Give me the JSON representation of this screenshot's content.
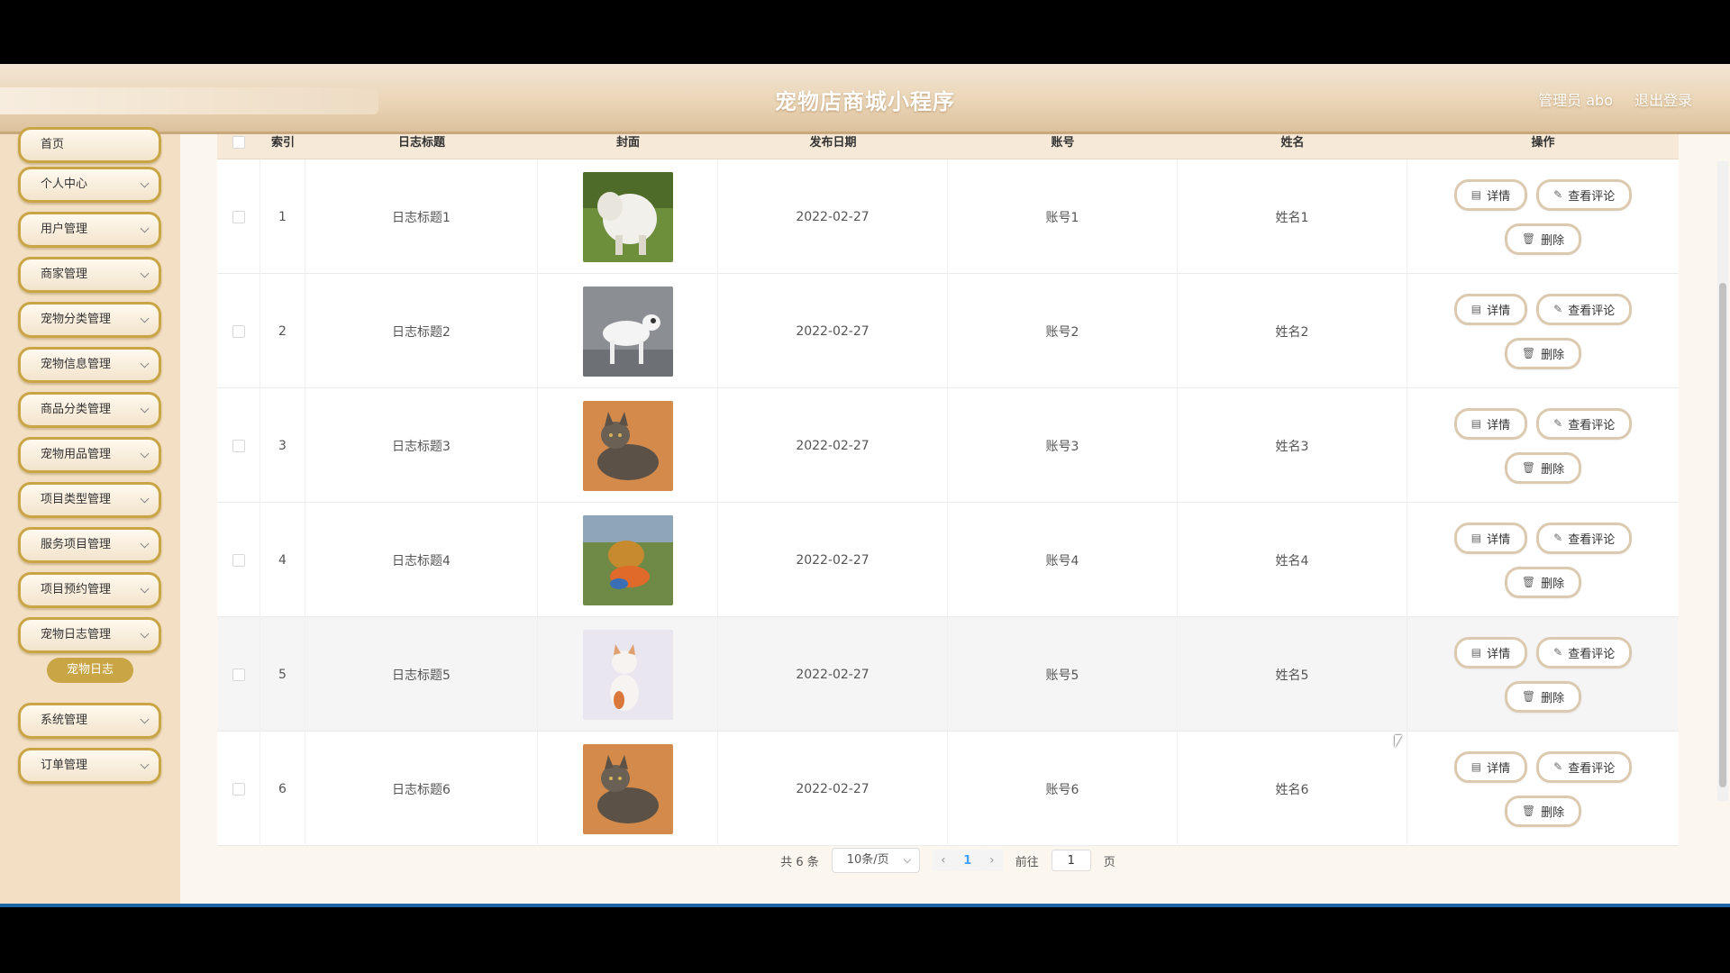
{
  "header": {
    "title": "宠物店商城小程序",
    "user_label": "管理员 abo",
    "logout_label": "退出登录"
  },
  "sidebar": {
    "items": [
      {
        "label": "首页"
      },
      {
        "label": "个人中心"
      },
      {
        "label": "用户管理"
      },
      {
        "label": "商家管理"
      },
      {
        "label": "宠物分类管理"
      },
      {
        "label": "宠物信息管理"
      },
      {
        "label": "商品分类管理"
      },
      {
        "label": "宠物用品管理"
      },
      {
        "label": "项目类型管理"
      },
      {
        "label": "服务项目管理"
      },
      {
        "label": "项目预约管理"
      },
      {
        "label": "宠物日志管理"
      },
      {
        "label": "系统管理"
      },
      {
        "label": "订单管理"
      }
    ],
    "active_submenu": "宠物日志"
  },
  "table": {
    "columns": [
      "索引",
      "日志标题",
      "封面",
      "发布日期",
      "账号",
      "姓名",
      "操作"
    ],
    "rows": [
      {
        "index": "1",
        "title": "日志标题1",
        "date": "2022-02-27",
        "account": "账号1",
        "name": "姓名1",
        "cover": "white shaggy dog"
      },
      {
        "index": "2",
        "title": "日志标题2",
        "date": "2022-02-27",
        "account": "账号2",
        "name": "姓名2",
        "cover": "white bull terrier"
      },
      {
        "index": "3",
        "title": "日志标题3",
        "date": "2022-02-27",
        "account": "账号3",
        "name": "姓名3",
        "cover": "tabby cat"
      },
      {
        "index": "4",
        "title": "日志标题4",
        "date": "2022-02-27",
        "account": "账号4",
        "name": "姓名4",
        "cover": "golden retriever"
      },
      {
        "index": "5",
        "title": "日志标题5",
        "date": "2022-02-27",
        "account": "账号5",
        "name": "姓名5",
        "cover": "orange white cat"
      },
      {
        "index": "6",
        "title": "日志标题6",
        "date": "2022-02-27",
        "account": "账号6",
        "name": "姓名6",
        "cover": "tabby cat"
      }
    ],
    "actions": {
      "detail": "详情",
      "comments": "查看评论",
      "delete": "删除"
    }
  },
  "pagination": {
    "total_label": "共 6 条",
    "page_size": "10条/页",
    "current_page": "1",
    "goto_prefix": "前往",
    "goto_value": "1",
    "goto_suffix": "页"
  },
  "colors": {
    "accent_gold": "#c9a546",
    "header_beige": "#e9d3b4",
    "sidebar_bg": "#f2dfc4"
  }
}
